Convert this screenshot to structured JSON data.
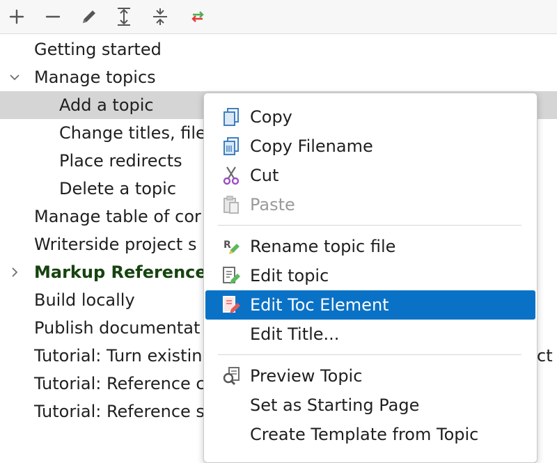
{
  "toolbar": {
    "buttons": [
      {
        "icon": "plus-icon"
      },
      {
        "icon": "minus-icon"
      },
      {
        "icon": "pencil-icon"
      },
      {
        "icon": "expand-all-icon"
      },
      {
        "icon": "collapse-all-icon"
      },
      {
        "icon": "swap-arrows-icon"
      }
    ]
  },
  "tree": {
    "items": [
      {
        "label": "Getting started"
      },
      {
        "label": "Manage topics",
        "expanded": true
      },
      {
        "label": "Add a topic",
        "selected": true
      },
      {
        "label": "Change titles, file"
      },
      {
        "label": "Place redirects"
      },
      {
        "label": "Delete a topic"
      },
      {
        "label": "Manage table of cor"
      },
      {
        "label": "Writerside project s"
      },
      {
        "label": "Markup Reference",
        "expanded": false
      },
      {
        "label": "Build locally"
      },
      {
        "label": "Publish documentat"
      },
      {
        "label": "Tutorial: Turn existin",
        "suffix": "ct"
      },
      {
        "label": "Tutorial: Reference c"
      },
      {
        "label": "Tutorial: Reference s"
      }
    ]
  },
  "context_menu": {
    "items": [
      {
        "label": "Copy",
        "icon": "copy-icon"
      },
      {
        "label": "Copy Filename",
        "icon": "copy-filename-icon"
      },
      {
        "label": "Cut",
        "icon": "scissors-icon"
      },
      {
        "label": "Paste",
        "icon": "paste-icon",
        "disabled": true
      },
      {
        "label": "Rename topic file",
        "icon": "rename-file-icon"
      },
      {
        "label": "Edit topic",
        "icon": "edit-topic-icon"
      },
      {
        "label": "Edit Toc Element",
        "icon": "edit-toc-icon",
        "highlighted": true
      },
      {
        "label": "Edit Title..."
      },
      {
        "label": "Preview Topic",
        "icon": "preview-icon"
      },
      {
        "label": "Set as Starting Page"
      },
      {
        "label": "Create Template from Topic"
      }
    ]
  },
  "colors": {
    "highlight": "#0a72c6",
    "selected_row": "#d5d5d5",
    "bold_item": "#16430f"
  }
}
